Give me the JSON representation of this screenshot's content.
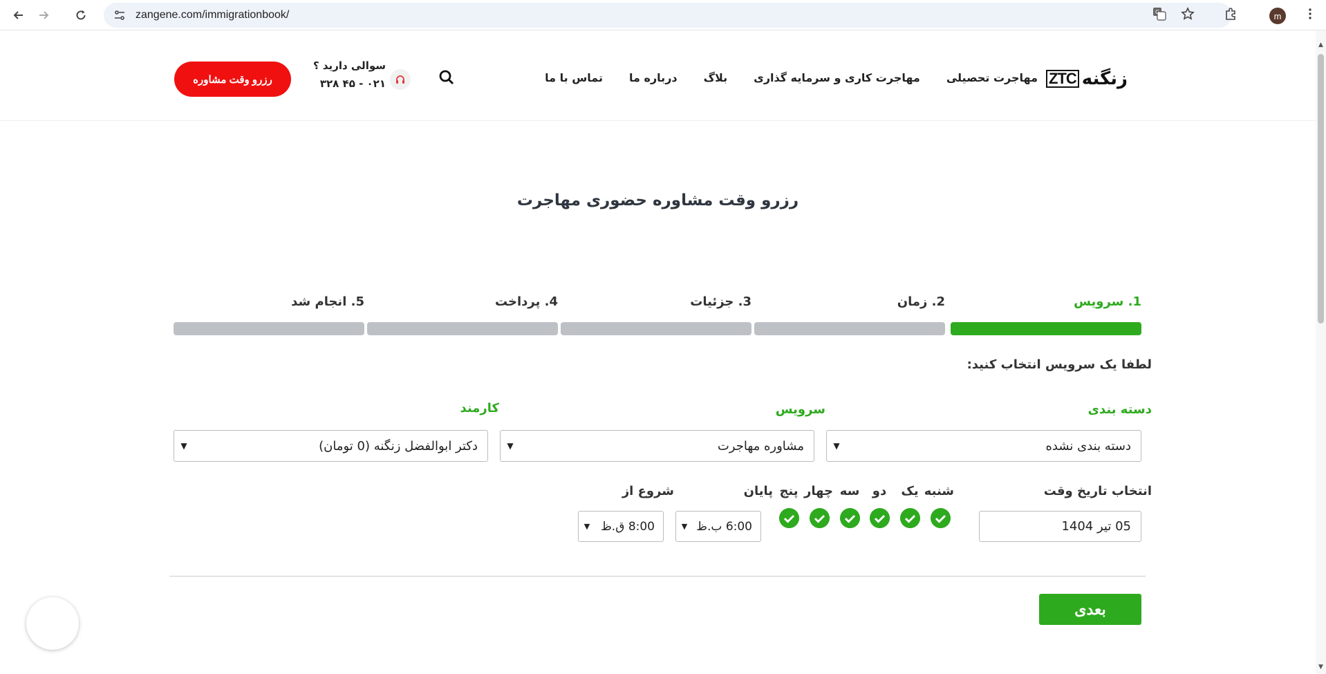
{
  "browser": {
    "url": "zangene.com/immigrationbook/",
    "profile_initial": "m"
  },
  "header": {
    "logo_fa": "زنگنه",
    "logo_en": "ZTC",
    "nav": [
      {
        "label": "مهاجرت تحصیلی"
      },
      {
        "label": "مهاجرت کاری و سرمایه گذاری"
      },
      {
        "label": "بلاگ"
      },
      {
        "label": "درباره ما"
      },
      {
        "label": "تماس با ما"
      }
    ],
    "question": "سوالی دارید ؟",
    "phone": "۰۲۱ - ۴۵ ۳۲۸",
    "book_button": "رزرو وقت مشاوره"
  },
  "page": {
    "title": "رزرو وقت مشاوره حضوری مهاجرت",
    "steps": [
      {
        "label": "1. سرویس",
        "active": true
      },
      {
        "label": "2. زمان",
        "active": false
      },
      {
        "label": "3. جزئیات",
        "active": false
      },
      {
        "label": "4. پرداخت",
        "active": false
      },
      {
        "label": "5. انجام شد",
        "active": false
      }
    ],
    "prompt": "لطفا یک سرویس انتخاب کنید:",
    "category": {
      "label": "دسته بندی",
      "value": "دسته بندی نشده"
    },
    "service": {
      "label": "سرویس",
      "value": "مشاوره مهاجرت"
    },
    "employee": {
      "label": "کارمند",
      "value": "دکتر ابوالفضل زنگنه (0 تومان)"
    },
    "date_label": "انتخاب تاریخ وقت",
    "date_value": "05 تیر 1404",
    "days": [
      {
        "name": "شنبه",
        "checked": true
      },
      {
        "name": "یک",
        "checked": true
      },
      {
        "name": "دو",
        "checked": true
      },
      {
        "name": "سه",
        "checked": true
      },
      {
        "name": "چهار",
        "checked": true
      },
      {
        "name": "پنج",
        "checked": true
      }
    ],
    "end_label": "پایان",
    "end_value": "6:00 ب.ظ",
    "start_label": "شروع از",
    "start_value": "8:00 ق.ظ",
    "next_button": "بعدی"
  },
  "colors": {
    "accent_green": "#2eaa1e",
    "brand_red": "#f01010",
    "step_inactive": "#bdc1c6"
  }
}
